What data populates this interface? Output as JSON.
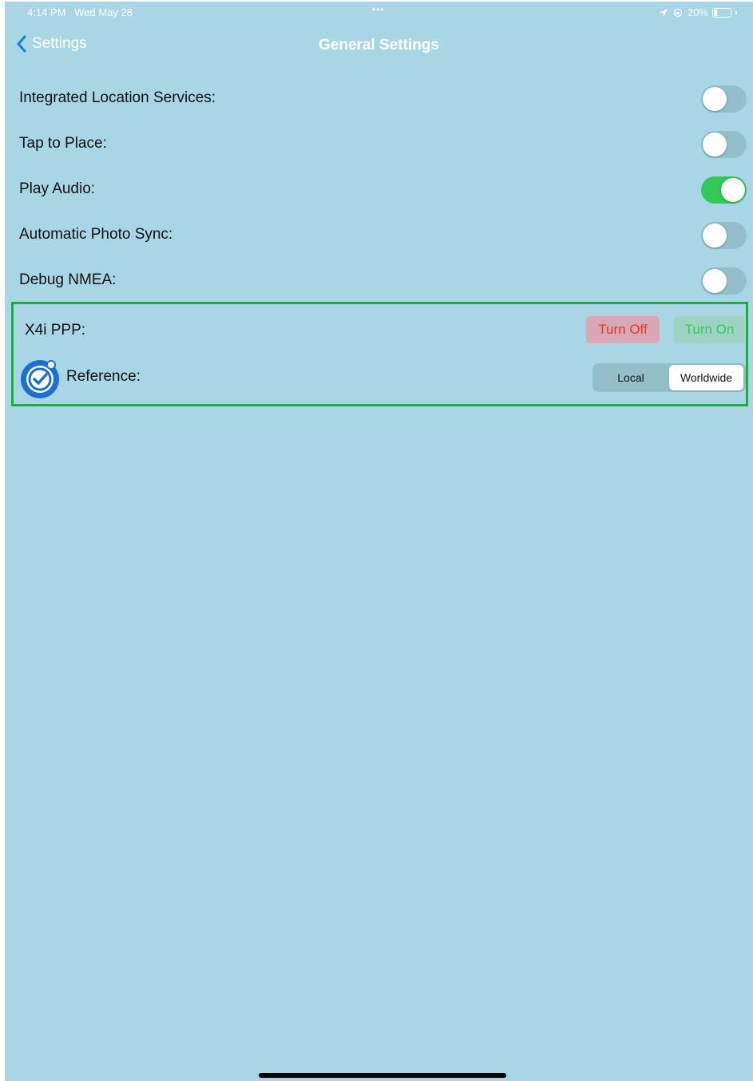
{
  "status_bar": {
    "time": "4:14 PM",
    "date": "Wed May 28",
    "dots": "•••",
    "battery_text": "20%",
    "battery_level": 0.2
  },
  "nav": {
    "back_label": "Settings",
    "title": "General Settings"
  },
  "settings": [
    {
      "label": "Integrated Location Services:",
      "on": false
    },
    {
      "label": "Tap to Place:",
      "on": false
    },
    {
      "label": "Play Audio:",
      "on": true
    },
    {
      "label": "Automatic Photo Sync:",
      "on": false
    },
    {
      "label": "Debug NMEA:",
      "on": false
    }
  ],
  "ppp": {
    "label": "X4i PPP:",
    "turn_off_label": "Turn Off",
    "turn_on_label": "Turn On"
  },
  "reference": {
    "label": "Reference:",
    "options": [
      "Local",
      "Worldwide"
    ],
    "selected": "Worldwide"
  },
  "colors": {
    "background": "#a9d6e5",
    "toggle_on": "#34c759",
    "highlight_border": "#1fae3b",
    "turn_off_text": "#e8352e",
    "turn_on_text": "#34c759",
    "back_chevron": "#1a7cf0"
  }
}
